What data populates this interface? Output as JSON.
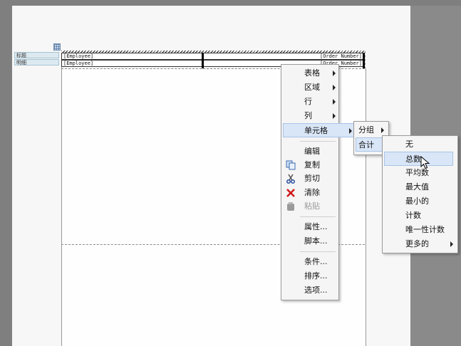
{
  "report": {
    "row_labels": [
      "标题",
      "明细"
    ],
    "header_row": {
      "left": "[Employee]",
      "right": "[Order Number]"
    },
    "detail_row": {
      "left": "[Employee]",
      "right": "[Order Number]"
    }
  },
  "context_menu": {
    "items": [
      {
        "label": "表格",
        "submenu": true
      },
      {
        "label": "区域",
        "submenu": true
      },
      {
        "label": "行",
        "submenu": true
      },
      {
        "label": "列",
        "submenu": true
      },
      {
        "label": "单元格",
        "submenu": true,
        "highlighted": true
      },
      {
        "label": "编辑"
      },
      {
        "label": "复制",
        "icon": "copy-icon"
      },
      {
        "label": "剪切",
        "icon": "cut-icon"
      },
      {
        "label": "清除",
        "icon": "delete-icon"
      },
      {
        "label": "粘贴",
        "icon": "paste-icon",
        "disabled": true
      },
      {
        "label": "属性..."
      },
      {
        "label": "脚本..."
      },
      {
        "label": "条件..."
      },
      {
        "label": "排序..."
      },
      {
        "label": "选项..."
      }
    ]
  },
  "cell_submenu": {
    "items": [
      {
        "label": "分组",
        "submenu": true
      },
      {
        "label": "合计",
        "submenu": true,
        "highlighted": true
      }
    ]
  },
  "total_submenu": {
    "items": [
      {
        "label": "无"
      },
      {
        "label": "总数",
        "highlighted": true
      },
      {
        "label": "平均数"
      },
      {
        "label": "最大值"
      },
      {
        "label": "最小的"
      },
      {
        "label": "计数"
      },
      {
        "label": "唯一性计数"
      },
      {
        "label": "更多的",
        "submenu": true
      }
    ]
  },
  "colors": {
    "menu_highlight": "#d9e6f7",
    "menu_background": "#f5f5f5",
    "label_background": "#dce9f0"
  }
}
